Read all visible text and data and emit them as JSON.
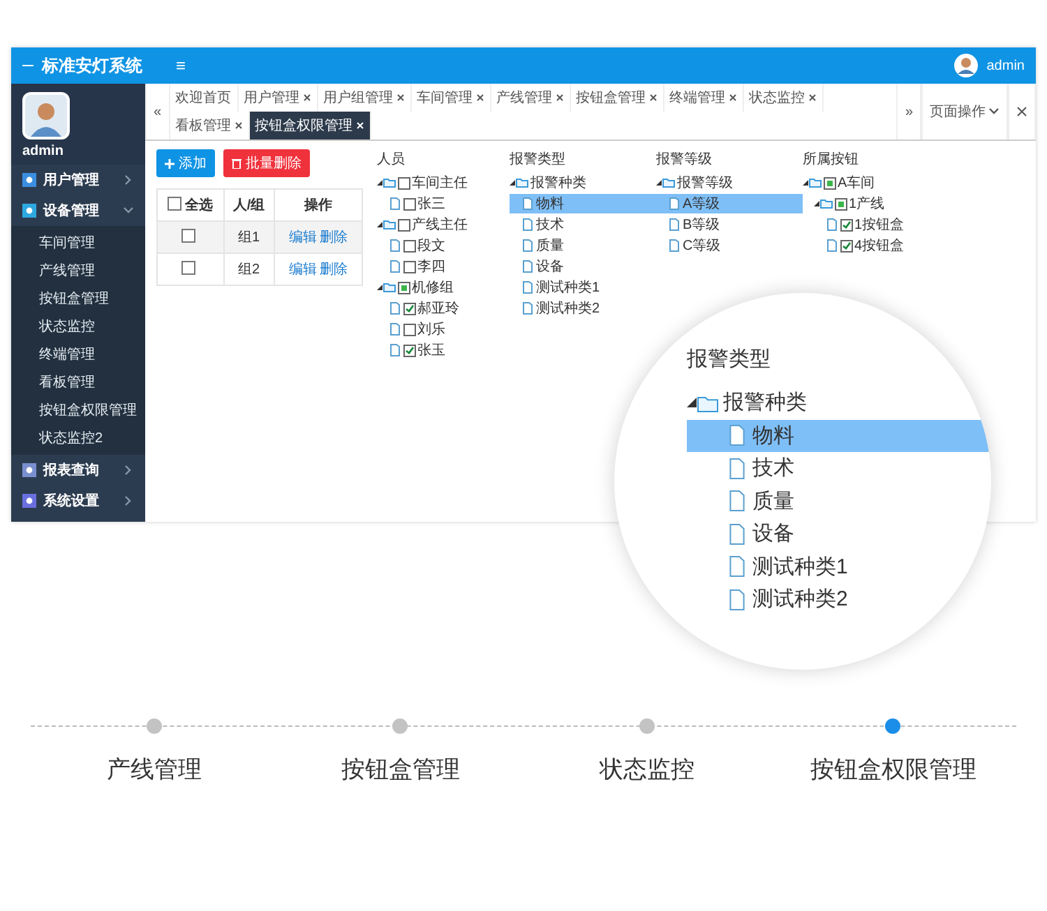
{
  "header": {
    "title": "标准安灯系统",
    "menu": "≡",
    "user": "admin"
  },
  "sidebar": {
    "user": "admin",
    "items": [
      {
        "label": "用户管理",
        "expanded": false
      },
      {
        "label": "设备管理",
        "expanded": true,
        "children": [
          {
            "label": "车间管理"
          },
          {
            "label": "产线管理"
          },
          {
            "label": "按钮盒管理"
          },
          {
            "label": "状态监控"
          },
          {
            "label": "终端管理"
          },
          {
            "label": "看板管理"
          },
          {
            "label": "按钮盒权限管理"
          },
          {
            "label": "状态监控2"
          }
        ]
      },
      {
        "label": "报表查询",
        "expanded": false
      },
      {
        "label": "系统设置",
        "expanded": false
      }
    ]
  },
  "tab_bar": {
    "scroll_left": "«",
    "tabs": [
      {
        "label": "欢迎首页",
        "selected": false,
        "closable": false
      },
      {
        "label": "用户管理",
        "selected": false,
        "closable": true
      },
      {
        "label": "用户组管理",
        "selected": false,
        "closable": true
      },
      {
        "label": "车间管理",
        "selected": false,
        "closable": true
      },
      {
        "label": "产线管理",
        "selected": false,
        "closable": true
      },
      {
        "label": "按钮盒管理",
        "selected": false,
        "closable": true
      },
      {
        "label": "终端管理",
        "selected": false,
        "closable": true
      },
      {
        "label": "状态监控",
        "selected": false,
        "closable": true
      },
      {
        "label": "看板管理",
        "selected": false,
        "closable": true
      },
      {
        "label": "按钮盒权限管理",
        "selected": true,
        "closable": true
      }
    ],
    "scroll_right": "»",
    "page_actions": "页面操作"
  },
  "toolbar": {
    "add": "添加",
    "batch_delete": "批量删除"
  },
  "table": {
    "columns": [
      "全选",
      "人/组",
      "操作"
    ],
    "header_checked": false,
    "rows": [
      {
        "checked": false,
        "name": "组1",
        "actions": [
          "编辑",
          "删除"
        ]
      },
      {
        "checked": false,
        "name": "组2",
        "actions": [
          "编辑",
          "删除"
        ]
      }
    ]
  },
  "trees": [
    {
      "title": "人员",
      "nodes": [
        {
          "label": "车间主任",
          "checked": false,
          "partial": false,
          "children": [
            {
              "label": "张三",
              "checked": false,
              "partial": false
            }
          ]
        },
        {
          "label": "产线主任",
          "checked": false,
          "partial": false,
          "children": [
            {
              "label": "段文",
              "checked": false,
              "partial": false
            },
            {
              "label": "李四",
              "checked": false,
              "partial": false
            }
          ]
        },
        {
          "label": "机修组",
          "checked": false,
          "partial": true,
          "children": [
            {
              "label": "郝亚玲",
              "checked": true,
              "partial": false
            },
            {
              "label": "刘乐",
              "checked": false,
              "partial": false
            },
            {
              "label": "张玉",
              "checked": true,
              "partial": false
            }
          ]
        }
      ]
    },
    {
      "title": "报警类型",
      "nodes": [
        {
          "label": "报警种类",
          "selected": false,
          "children": [
            {
              "label": "物料",
              "selected": true
            },
            {
              "label": "技术",
              "selected": false
            },
            {
              "label": "质量",
              "selected": false
            },
            {
              "label": "设备",
              "selected": false
            },
            {
              "label": "测试种类1",
              "selected": false
            },
            {
              "label": "测试种类2",
              "selected": false
            }
          ]
        }
      ]
    },
    {
      "title": "报警等级",
      "nodes": [
        {
          "label": "报警等级",
          "selected": false,
          "children": [
            {
              "label": "A等级",
              "selected": true
            },
            {
              "label": "B等级",
              "selected": false
            },
            {
              "label": "C等级",
              "selected": false
            }
          ]
        }
      ]
    },
    {
      "title": "所属按钮",
      "nodes": [
        {
          "label": "A车间",
          "checked": false,
          "partial": true,
          "children": [
            {
              "label": "1产线",
              "checked": false,
              "partial": true,
              "children": [
                {
                  "label": "1按钮盒",
                  "checked": true,
                  "partial": false
                },
                {
                  "label": "4按钮盒",
                  "checked": true,
                  "partial": false
                }
              ]
            }
          ]
        }
      ]
    }
  ],
  "magnifier": {
    "title": "报警类型",
    "nodes": [
      {
        "label": "报警种类",
        "selected": false,
        "children": [
          {
            "label": "物料",
            "selected": true
          },
          {
            "label": "技术",
            "selected": false
          },
          {
            "label": "质量",
            "selected": false
          },
          {
            "label": "设备",
            "selected": false
          },
          {
            "label": "测试种类1",
            "selected": false
          },
          {
            "label": "测试种类2",
            "selected": false
          }
        ]
      }
    ]
  },
  "timeline": {
    "steps": [
      {
        "label": "产线管理",
        "selected": false
      },
      {
        "label": "按钮盒管理",
        "selected": false
      },
      {
        "label": "状态监控",
        "selected": false
      },
      {
        "label": "按钮盒权限管理",
        "selected": true
      }
    ]
  }
}
